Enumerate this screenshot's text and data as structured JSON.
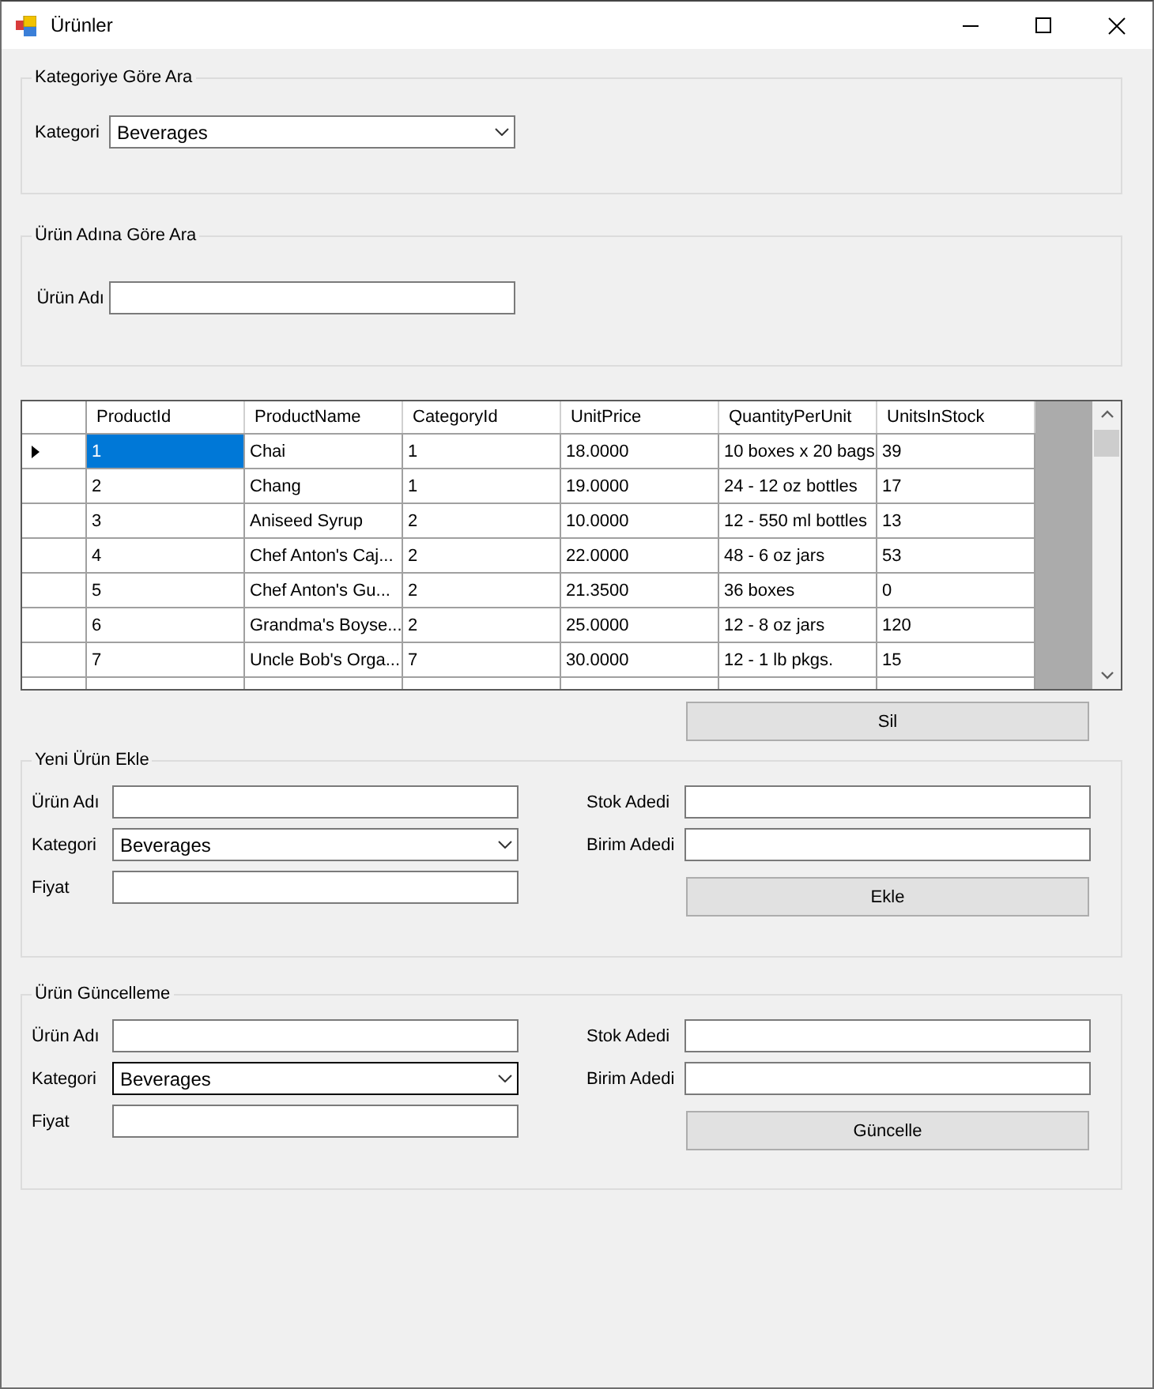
{
  "window": {
    "title": "Ürünler"
  },
  "category_search": {
    "title": "Kategoriye Göre Ara",
    "field": {
      "kind": "combo",
      "label": "Kategori",
      "value": "Beverages",
      "focused": false
    }
  },
  "name_search": {
    "title": "Ürün Adına Göre Ara",
    "field": {
      "kind": "text",
      "label": "Ürün Adı"
    }
  },
  "products_table": {
    "columns": [
      "ProductId",
      "ProductName",
      "CategoryId",
      "UnitPrice",
      "QuantityPerUnit",
      "UnitsInStock"
    ],
    "rows": [
      {
        "selected": true,
        "cells": [
          "1",
          "Chai",
          "1",
          "18.0000",
          "10 boxes x 20 bags",
          "39"
        ]
      },
      {
        "selected": false,
        "cells": [
          "2",
          "Chang",
          "1",
          "19.0000",
          "24 - 12 oz bottles",
          "17"
        ]
      },
      {
        "selected": false,
        "cells": [
          "3",
          "Aniseed Syrup",
          "2",
          "10.0000",
          "12 - 550 ml bottles",
          "13"
        ]
      },
      {
        "selected": false,
        "cells": [
          "4",
          "Chef Anton's Caj...",
          "2",
          "22.0000",
          "48 - 6 oz jars",
          "53"
        ]
      },
      {
        "selected": false,
        "cells": [
          "5",
          "Chef Anton's Gu...",
          "2",
          "21.3500",
          "36 boxes",
          "0"
        ]
      },
      {
        "selected": false,
        "cells": [
          "6",
          "Grandma's Boyse...",
          "2",
          "25.0000",
          "12 - 8 oz jars",
          "120"
        ]
      },
      {
        "selected": false,
        "cells": [
          "7",
          "Uncle Bob's Orga...",
          "7",
          "30.0000",
          "12 - 1 lb pkgs.",
          "15"
        ]
      }
    ]
  },
  "delete_button": "Sil",
  "add_product": {
    "title": "Yeni Ürün Ekle",
    "left_fields": [
      {
        "kind": "text",
        "label": "Ürün Adı"
      },
      {
        "kind": "combo",
        "label": "Kategori",
        "value": "Beverages",
        "focused": false
      },
      {
        "kind": "text",
        "label": "Fiyat"
      }
    ],
    "right_fields": [
      {
        "kind": "text",
        "label": "Stok Adedi"
      },
      {
        "kind": "text",
        "label": "Birim Adedi"
      }
    ],
    "button": "Ekle"
  },
  "update_product": {
    "title": "Ürün Güncelleme",
    "left_fields": [
      {
        "kind": "text",
        "label": "Ürün Adı"
      },
      {
        "kind": "combo",
        "label": "Kategori",
        "value": "Beverages",
        "focused": true
      },
      {
        "kind": "text",
        "label": "Fiyat"
      }
    ],
    "right_fields": [
      {
        "kind": "text",
        "label": "Stok Adedi"
      },
      {
        "kind": "text",
        "label": "Birim Adedi"
      }
    ],
    "button": "Güncelle"
  }
}
